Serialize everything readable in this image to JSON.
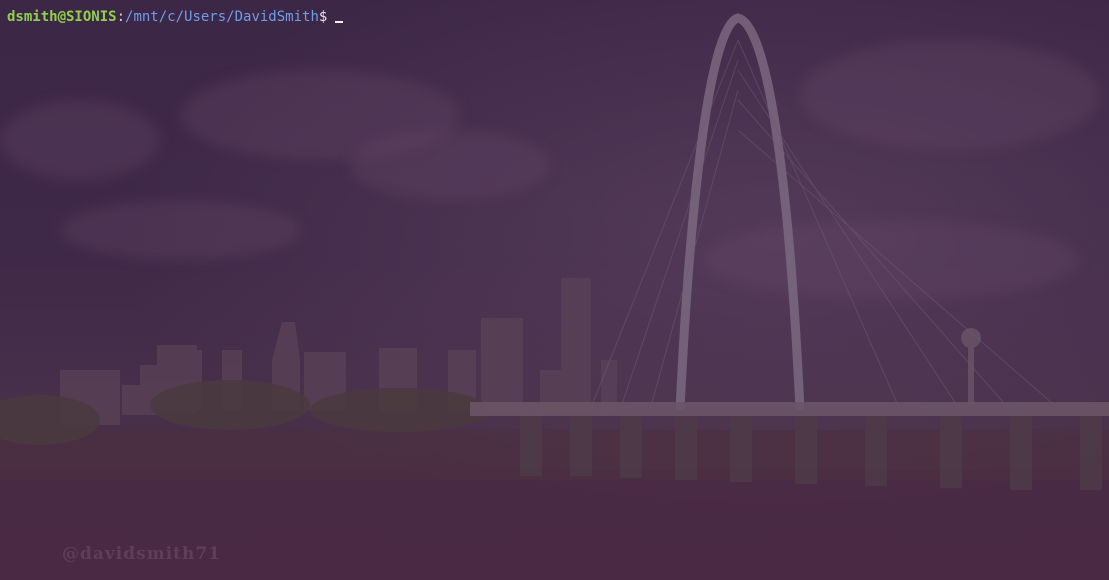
{
  "terminal": {
    "user_host": "dsmith@SIONIS",
    "separator": ":",
    "path": "/mnt/c/Users/DavidSmith",
    "prompt_symbol": "$"
  },
  "background": {
    "watermark": "@davidsmith71"
  },
  "colors": {
    "user_host": "#8fd14a",
    "path": "#6f9de6",
    "background": "#3e2846"
  }
}
